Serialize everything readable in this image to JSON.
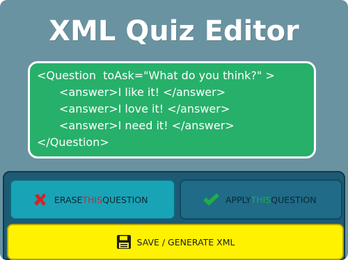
{
  "app": {
    "title": "XML Quiz Editor"
  },
  "editor": {
    "lines": [
      "<Question  toAsk=\"What do you think?\" >",
      "<answer>I like it! </answer>",
      "<answer>I love it! </answer>",
      "<answer>I need it! </answer>",
      "</Question>"
    ]
  },
  "buttons": {
    "erase": {
      "pre": "ERASE ",
      "accent": "THIS",
      "post": " QUESTION",
      "icon": "x-icon"
    },
    "apply": {
      "pre": "APPLY ",
      "accent": "THIS",
      "post": " QUESTION",
      "icon": "checkmark-icon"
    },
    "save": {
      "label": "SAVE / GENERATE XML",
      "icon": "floppy-disk-icon"
    }
  },
  "colors": {
    "background": "#6a93a1",
    "editor": "#27b06a",
    "panel": "#1d5a74",
    "erase_button": "#19a3b6",
    "apply_button": "#1f6b88",
    "save_button": "#fff200",
    "accent_red": "#d92020",
    "accent_green": "#1fae43"
  }
}
